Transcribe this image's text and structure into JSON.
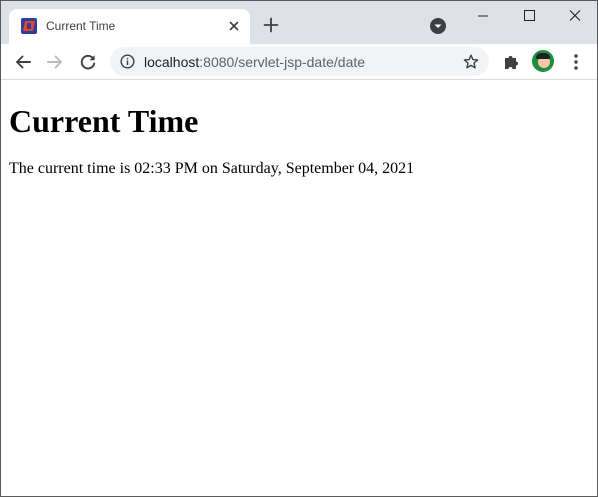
{
  "browser": {
    "tab": {
      "title": "Current Time"
    },
    "address_bar": {
      "host": "localhost",
      "rest": ":8080/servlet-jsp-date/date"
    },
    "accent_colors": {
      "tabstrip": "#dee1e6",
      "omnibox": "#f1f3f4",
      "icon": "#5f6368"
    },
    "icons": {
      "favicon": "jetbrains-app-icon",
      "tab_close": "close-icon",
      "new_tab": "plus-icon",
      "tab_search": "chevron-down-icon",
      "minimize": "minimize-icon",
      "maximize": "maximize-icon",
      "close_window": "close-icon",
      "back": "arrow-left-icon",
      "forward": "arrow-right-icon",
      "reload": "reload-icon",
      "site_info": "info-icon",
      "bookmark": "star-icon",
      "extensions": "puzzle-icon",
      "profile": "avatar",
      "menu": "kebab-menu-icon"
    }
  },
  "page": {
    "heading": "Current Time",
    "text": "The current time is 02:33 PM on Saturday, September 04, 2021"
  }
}
